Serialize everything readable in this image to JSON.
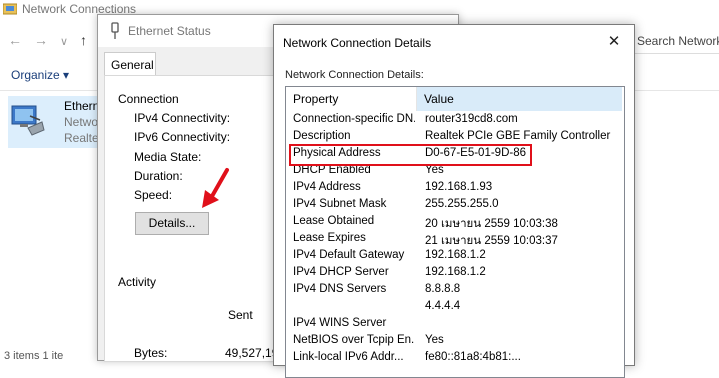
{
  "network_connections": {
    "title": "Network Connections",
    "search_placeholder": "Search Network",
    "organize_label": "Organize ▾",
    "nav": {
      "back": "←",
      "forward": "→",
      "dropdown": "∨",
      "up": "↑"
    },
    "item": {
      "name": "Etherne",
      "line2": "Netwo",
      "line3": "Realte"
    },
    "status_bar": "3 items   1 ite"
  },
  "ethernet_status": {
    "title": "Ethernet Status",
    "tab": "General",
    "connection_heading": "Connection",
    "fields": [
      "IPv4 Connectivity:",
      "IPv6 Connectivity:",
      "Media State:",
      "Duration:",
      "Speed:"
    ],
    "details_button": "Details...",
    "activity_heading": "Activity",
    "sent_label": "Sent",
    "bytes_label": "Bytes:",
    "bytes_sent": "49,527,19"
  },
  "details_dialog": {
    "title": "Network Connection Details",
    "close_glyph": "✕",
    "subtitle": "Network Connection Details:",
    "columns": {
      "property": "Property",
      "value": "Value"
    },
    "rows": [
      {
        "property": "Connection-specific DN...",
        "value": "router319cd8.com"
      },
      {
        "property": "Description",
        "value": "Realtek PCIe GBE Family Controller"
      },
      {
        "property": "Physical Address",
        "value": "D0-67-E5-01-9D-86"
      },
      {
        "property": "DHCP Enabled",
        "value": "Yes"
      },
      {
        "property": "IPv4 Address",
        "value": "192.168.1.93"
      },
      {
        "property": "IPv4 Subnet Mask",
        "value": "255.255.255.0"
      },
      {
        "property": "Lease Obtained",
        "value": "20 เมษายน 2559 10:03:38"
      },
      {
        "property": "Lease Expires",
        "value": "21 เมษายน 2559 10:03:37"
      },
      {
        "property": "IPv4 Default Gateway",
        "value": "192.168.1.2"
      },
      {
        "property": "IPv4 DHCP Server",
        "value": "192.168.1.2"
      },
      {
        "property": "IPv4 DNS Servers",
        "value": "8.8.8.8"
      },
      {
        "property": "",
        "value": "4.4.4.4"
      },
      {
        "property": "IPv4 WINS Server",
        "value": ""
      },
      {
        "property": "NetBIOS over Tcpip En...",
        "value": "Yes"
      },
      {
        "property": "Link-local IPv6 Addr...",
        "value": "fe80::81a8:4b81:..."
      }
    ],
    "highlighted_property": "Physical Address"
  },
  "colors": {
    "highlight_border": "#e0101a",
    "arrow": "#e0101a",
    "value_header_bg": "#d9ebf9",
    "selection": "#dceefc"
  }
}
